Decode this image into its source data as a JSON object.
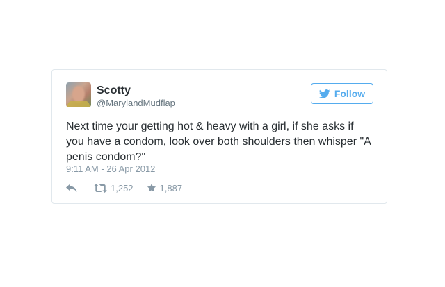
{
  "tweet": {
    "name": "Scotty",
    "handle": "@MarylandMudflap",
    "text": "Next time your getting hot & heavy with a girl, if she asks if you have a condom, look over both shoulders then whisper \"A penis condom?\"",
    "timestamp": "9:11 AM - 26 Apr 2012",
    "retweets": "1,252",
    "favorites": "1,887"
  },
  "follow_button": {
    "label": "Follow"
  },
  "icons": {
    "brand": "twitter-bird-icon",
    "reply": "reply-icon",
    "retweet": "retweet-icon",
    "favorite": "star-icon"
  },
  "colors": {
    "accent": "#55acee",
    "text": "#292f33",
    "muted": "#8899a6",
    "border": "#e1e8ed"
  }
}
